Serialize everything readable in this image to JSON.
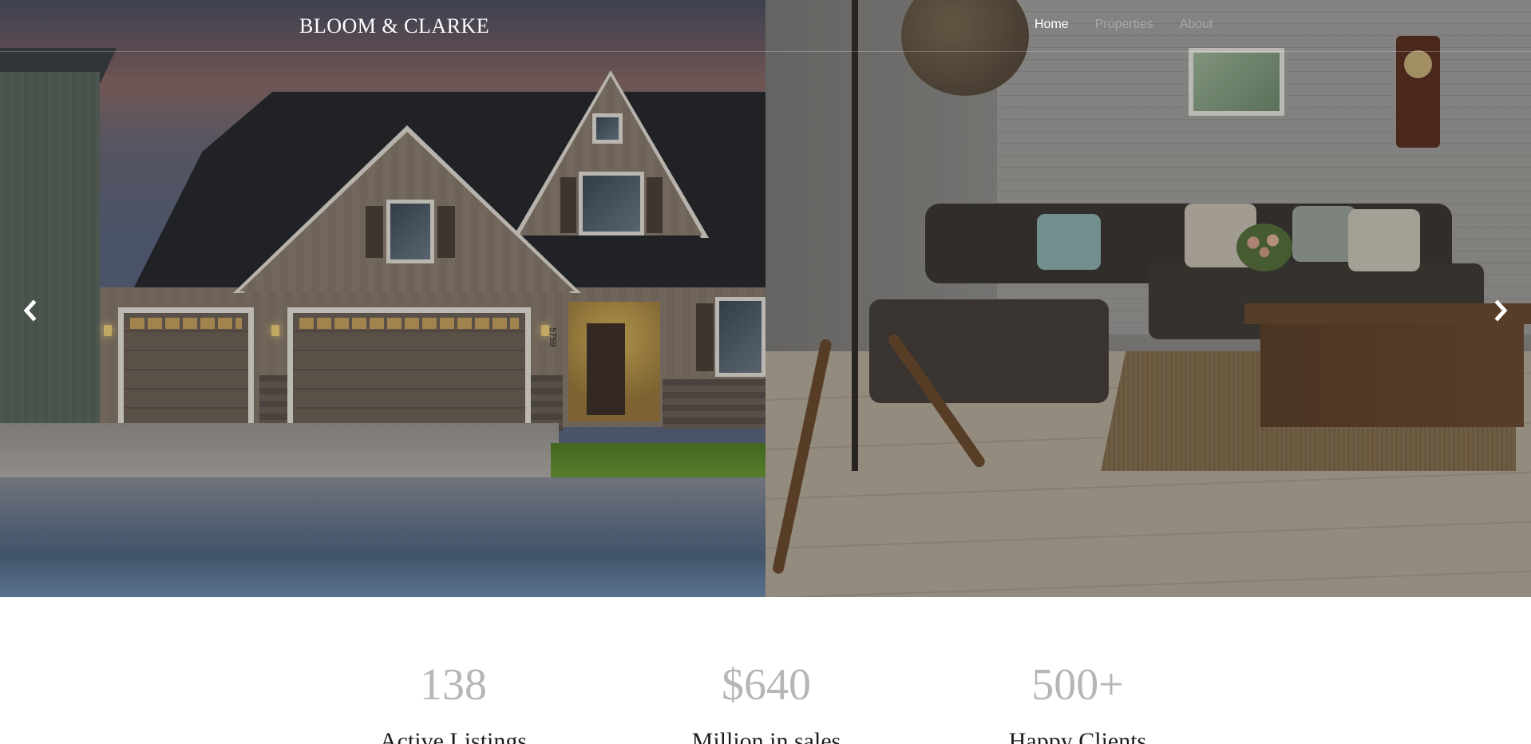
{
  "navbar": {
    "brand": "BLOOM & CLARKE",
    "links": [
      {
        "label": "Home",
        "active": true
      },
      {
        "label": "Properties",
        "active": false
      },
      {
        "label": "About",
        "active": false
      }
    ]
  },
  "carousel": {
    "prev_icon": "chevron-left-icon",
    "next_icon": "chevron-right-icon",
    "slides": [
      {
        "name": "house-exterior-photo",
        "house_number": "5759"
      },
      {
        "name": "living-room-photo"
      }
    ]
  },
  "stats": [
    {
      "value": "138",
      "label": "Active Listings"
    },
    {
      "value": "$640",
      "label": "Million in sales"
    },
    {
      "value": "500+",
      "label": "Happy Clients"
    }
  ],
  "colors": {
    "stat_value": "#b6b6b6",
    "stat_label": "#1c1c1c",
    "nav_active": "#ffffff",
    "nav_inactive": "#a9a9a9"
  }
}
